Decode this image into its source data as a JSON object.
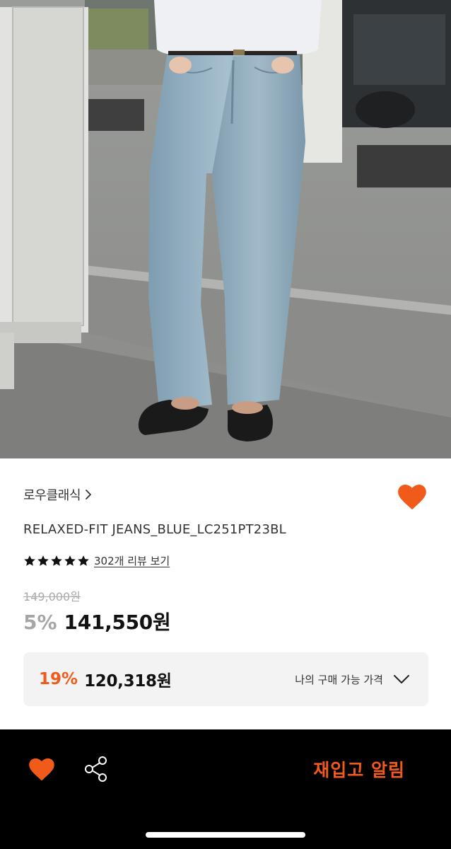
{
  "product": {
    "brand": "로우클래식",
    "title": "RELAXED-FIT JEANS_BLUE_LC251PT23BL",
    "rating": 5,
    "review_link": "302개 리뷰 보기",
    "original_price": "149,000원",
    "discount_rate": "5%",
    "sale_price": "141,550원"
  },
  "coupon": {
    "rate": "19%",
    "price": "120,318원",
    "label": "나의 구매 가능 가격"
  },
  "bottom_bar": {
    "restock_label": "재입고 알림"
  },
  "icons": {
    "brand_chevron": "chevron-right-icon",
    "wishlist_top": "heart-icon",
    "rating_star": "star-icon",
    "coupon_chevron": "chevron-down-icon",
    "wishlist_bottom": "heart-icon",
    "share": "share-icon"
  },
  "colors": {
    "accent": "#f05a1a",
    "bottom_bar": "#000000",
    "coupon_box": "#f3f3f3",
    "muted_price": "#aaaaaa"
  }
}
